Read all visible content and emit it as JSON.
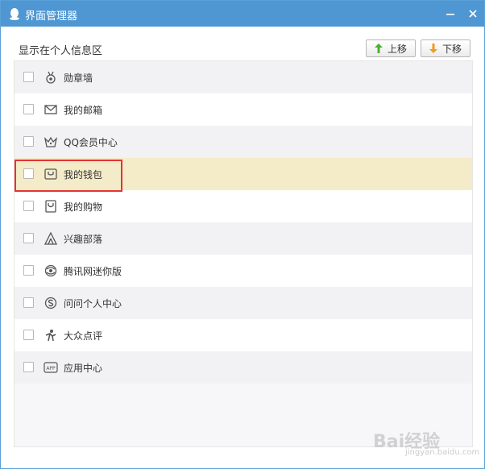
{
  "window": {
    "title": "界面管理器",
    "app_icon": "qq-penguin-icon",
    "colors": {
      "titlebar": "#4e97d3",
      "selected_row": "#f4ebc9",
      "highlight_border": "#e43333"
    }
  },
  "section": {
    "title": "显示在个人信息区"
  },
  "buttons": {
    "up_label": "上移",
    "down_label": "下移",
    "up_icon": "arrow-up-icon",
    "down_icon": "arrow-down-icon"
  },
  "items": [
    {
      "label": "勋章墙",
      "icon": "medal-icon",
      "checked": false
    },
    {
      "label": "我的邮箱",
      "icon": "mail-icon",
      "checked": false
    },
    {
      "label": "QQ会员中心",
      "icon": "crown-icon",
      "checked": false
    },
    {
      "label": "我的钱包",
      "icon": "wallet-icon",
      "checked": false,
      "selected": true
    },
    {
      "label": "我的购物",
      "icon": "shopping-bag-icon",
      "checked": false
    },
    {
      "label": "兴趣部落",
      "icon": "tent-icon",
      "checked": false
    },
    {
      "label": "腾讯网迷你版",
      "icon": "globe-icon",
      "checked": false
    },
    {
      "label": "问问个人中心",
      "icon": "wenwen-icon",
      "checked": false
    },
    {
      "label": "大众点评",
      "icon": "dianping-icon",
      "checked": false
    },
    {
      "label": "应用中心",
      "icon": "app-icon",
      "checked": false
    }
  ],
  "watermark": {
    "main": "Bai经验",
    "sub": "jingyan.baidu.com"
  }
}
